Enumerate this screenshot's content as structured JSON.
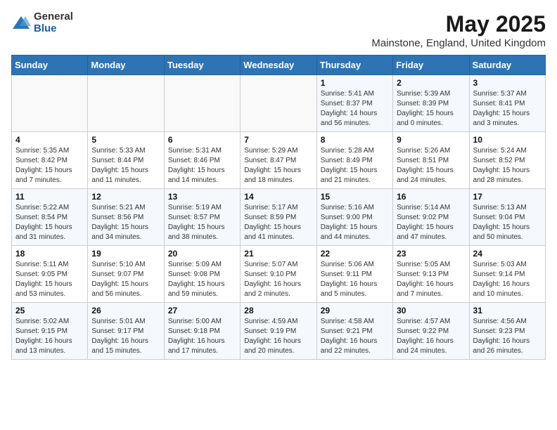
{
  "header": {
    "logo_general": "General",
    "logo_blue": "Blue",
    "title": "May 2025",
    "subtitle": "Mainstone, England, United Kingdom"
  },
  "weekdays": [
    "Sunday",
    "Monday",
    "Tuesday",
    "Wednesday",
    "Thursday",
    "Friday",
    "Saturday"
  ],
  "weeks": [
    [
      {
        "day": "",
        "info": ""
      },
      {
        "day": "",
        "info": ""
      },
      {
        "day": "",
        "info": ""
      },
      {
        "day": "",
        "info": ""
      },
      {
        "day": "1",
        "info": "Sunrise: 5:41 AM\nSunset: 8:37 PM\nDaylight: 14 hours and 56 minutes."
      },
      {
        "day": "2",
        "info": "Sunrise: 5:39 AM\nSunset: 8:39 PM\nDaylight: 15 hours and 0 minutes."
      },
      {
        "day": "3",
        "info": "Sunrise: 5:37 AM\nSunset: 8:41 PM\nDaylight: 15 hours and 3 minutes."
      }
    ],
    [
      {
        "day": "4",
        "info": "Sunrise: 5:35 AM\nSunset: 8:42 PM\nDaylight: 15 hours and 7 minutes."
      },
      {
        "day": "5",
        "info": "Sunrise: 5:33 AM\nSunset: 8:44 PM\nDaylight: 15 hours and 11 minutes."
      },
      {
        "day": "6",
        "info": "Sunrise: 5:31 AM\nSunset: 8:46 PM\nDaylight: 15 hours and 14 minutes."
      },
      {
        "day": "7",
        "info": "Sunrise: 5:29 AM\nSunset: 8:47 PM\nDaylight: 15 hours and 18 minutes."
      },
      {
        "day": "8",
        "info": "Sunrise: 5:28 AM\nSunset: 8:49 PM\nDaylight: 15 hours and 21 minutes."
      },
      {
        "day": "9",
        "info": "Sunrise: 5:26 AM\nSunset: 8:51 PM\nDaylight: 15 hours and 24 minutes."
      },
      {
        "day": "10",
        "info": "Sunrise: 5:24 AM\nSunset: 8:52 PM\nDaylight: 15 hours and 28 minutes."
      }
    ],
    [
      {
        "day": "11",
        "info": "Sunrise: 5:22 AM\nSunset: 8:54 PM\nDaylight: 15 hours and 31 minutes."
      },
      {
        "day": "12",
        "info": "Sunrise: 5:21 AM\nSunset: 8:56 PM\nDaylight: 15 hours and 34 minutes."
      },
      {
        "day": "13",
        "info": "Sunrise: 5:19 AM\nSunset: 8:57 PM\nDaylight: 15 hours and 38 minutes."
      },
      {
        "day": "14",
        "info": "Sunrise: 5:17 AM\nSunset: 8:59 PM\nDaylight: 15 hours and 41 minutes."
      },
      {
        "day": "15",
        "info": "Sunrise: 5:16 AM\nSunset: 9:00 PM\nDaylight: 15 hours and 44 minutes."
      },
      {
        "day": "16",
        "info": "Sunrise: 5:14 AM\nSunset: 9:02 PM\nDaylight: 15 hours and 47 minutes."
      },
      {
        "day": "17",
        "info": "Sunrise: 5:13 AM\nSunset: 9:04 PM\nDaylight: 15 hours and 50 minutes."
      }
    ],
    [
      {
        "day": "18",
        "info": "Sunrise: 5:11 AM\nSunset: 9:05 PM\nDaylight: 15 hours and 53 minutes."
      },
      {
        "day": "19",
        "info": "Sunrise: 5:10 AM\nSunset: 9:07 PM\nDaylight: 15 hours and 56 minutes."
      },
      {
        "day": "20",
        "info": "Sunrise: 5:09 AM\nSunset: 9:08 PM\nDaylight: 15 hours and 59 minutes."
      },
      {
        "day": "21",
        "info": "Sunrise: 5:07 AM\nSunset: 9:10 PM\nDaylight: 16 hours and 2 minutes."
      },
      {
        "day": "22",
        "info": "Sunrise: 5:06 AM\nSunset: 9:11 PM\nDaylight: 16 hours and 5 minutes."
      },
      {
        "day": "23",
        "info": "Sunrise: 5:05 AM\nSunset: 9:13 PM\nDaylight: 16 hours and 7 minutes."
      },
      {
        "day": "24",
        "info": "Sunrise: 5:03 AM\nSunset: 9:14 PM\nDaylight: 16 hours and 10 minutes."
      }
    ],
    [
      {
        "day": "25",
        "info": "Sunrise: 5:02 AM\nSunset: 9:15 PM\nDaylight: 16 hours and 13 minutes."
      },
      {
        "day": "26",
        "info": "Sunrise: 5:01 AM\nSunset: 9:17 PM\nDaylight: 16 hours and 15 minutes."
      },
      {
        "day": "27",
        "info": "Sunrise: 5:00 AM\nSunset: 9:18 PM\nDaylight: 16 hours and 17 minutes."
      },
      {
        "day": "28",
        "info": "Sunrise: 4:59 AM\nSunset: 9:19 PM\nDaylight: 16 hours and 20 minutes."
      },
      {
        "day": "29",
        "info": "Sunrise: 4:58 AM\nSunset: 9:21 PM\nDaylight: 16 hours and 22 minutes."
      },
      {
        "day": "30",
        "info": "Sunrise: 4:57 AM\nSunset: 9:22 PM\nDaylight: 16 hours and 24 minutes."
      },
      {
        "day": "31",
        "info": "Sunrise: 4:56 AM\nSunset: 9:23 PM\nDaylight: 16 hours and 26 minutes."
      }
    ]
  ]
}
